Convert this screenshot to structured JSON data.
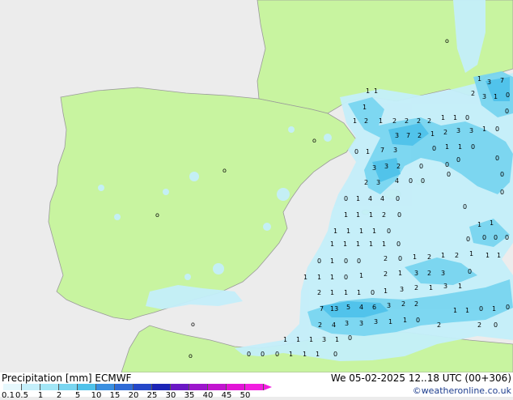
{
  "title": "Precipitation [mm] ECMWF",
  "valid_time": "We 05-02-2025 12..18 UTC (00+306)",
  "credit": "©weatheronline.co.uk",
  "colorbar": {
    "labels": [
      "0.1",
      "0.5",
      "1",
      "2",
      "5",
      "10",
      "15",
      "20",
      "25",
      "30",
      "35",
      "40",
      "45",
      "50"
    ],
    "colors": [
      "#e6f8fd",
      "#c4effa",
      "#a2e6f6",
      "#79d5f0",
      "#4fc2ea",
      "#3a8fe0",
      "#2f6bd6",
      "#2547c8",
      "#1c25b6",
      "#6a18c4",
      "#9c16cc",
      "#c214d0",
      "#e214d6",
      "#f21ee0"
    ]
  },
  "map_values": [
    {
      "v": "1"
    },
    {
      "v": "1"
    },
    {
      "v": "1"
    },
    {
      "v": "1"
    },
    {
      "v": "2"
    },
    {
      "v": "1"
    },
    {
      "v": "2"
    },
    {
      "v": "2"
    },
    {
      "v": "2"
    },
    {
      "v": "2"
    },
    {
      "v": "1"
    },
    {
      "v": "1"
    },
    {
      "v": "0"
    },
    {
      "v": "3"
    },
    {
      "v": "7"
    },
    {
      "v": "2"
    },
    {
      "v": "1"
    },
    {
      "v": "2"
    },
    {
      "v": "3"
    },
    {
      "v": "3"
    },
    {
      "v": "1"
    },
    {
      "v": "0"
    },
    {
      "v": "0"
    },
    {
      "v": "1"
    },
    {
      "v": "7"
    },
    {
      "v": "3"
    },
    {
      "v": "0"
    },
    {
      "v": "1"
    },
    {
      "v": "1"
    },
    {
      "v": "0"
    },
    {
      "v": "3"
    },
    {
      "v": "3"
    },
    {
      "v": "2"
    },
    {
      "v": "0"
    },
    {
      "v": "0"
    },
    {
      "v": "2"
    },
    {
      "v": "3"
    },
    {
      "v": "4"
    },
    {
      "v": "0"
    },
    {
      "v": "0"
    },
    {
      "v": "0"
    },
    {
      "v": "1"
    },
    {
      "v": "4"
    },
    {
      "v": "4"
    },
    {
      "v": "0"
    },
    {
      "v": "1"
    },
    {
      "v": "1"
    },
    {
      "v": "1"
    },
    {
      "v": "2"
    },
    {
      "v": "0"
    },
    {
      "v": "1"
    },
    {
      "v": "1"
    },
    {
      "v": "1"
    },
    {
      "v": "1"
    },
    {
      "v": "0"
    },
    {
      "v": "1"
    },
    {
      "v": "1"
    },
    {
      "v": "1"
    },
    {
      "v": "1"
    },
    {
      "v": "1"
    },
    {
      "v": "0"
    },
    {
      "v": "0"
    },
    {
      "v": "1"
    },
    {
      "v": "0"
    },
    {
      "v": "0"
    },
    {
      "v": "2"
    },
    {
      "v": "0"
    },
    {
      "v": "1"
    },
    {
      "v": "2"
    },
    {
      "v": "1"
    },
    {
      "v": "2"
    },
    {
      "v": "1"
    },
    {
      "v": "1"
    },
    {
      "v": "1"
    },
    {
      "v": "1"
    },
    {
      "v": "0"
    },
    {
      "v": "1"
    },
    {
      "v": "2"
    },
    {
      "v": "1"
    },
    {
      "v": "3"
    },
    {
      "v": "2"
    },
    {
      "v": "3"
    },
    {
      "v": "0"
    },
    {
      "v": "2"
    },
    {
      "v": "1"
    },
    {
      "v": "1"
    },
    {
      "v": "1"
    },
    {
      "v": "0"
    },
    {
      "v": "1"
    },
    {
      "v": "3"
    },
    {
      "v": "2"
    },
    {
      "v": "1"
    },
    {
      "v": "3"
    },
    {
      "v": "1"
    },
    {
      "v": "7"
    },
    {
      "v": "13"
    },
    {
      "v": "5"
    },
    {
      "v": "4"
    },
    {
      "v": "6"
    },
    {
      "v": "3"
    },
    {
      "v": "2"
    },
    {
      "v": "2"
    },
    {
      "v": "2"
    },
    {
      "v": "4"
    },
    {
      "v": "3"
    },
    {
      "v": "3"
    },
    {
      "v": "3"
    },
    {
      "v": "1"
    },
    {
      "v": "1"
    },
    {
      "v": "0"
    },
    {
      "v": "1"
    },
    {
      "v": "1"
    },
    {
      "v": "1"
    },
    {
      "v": "3"
    },
    {
      "v": "1"
    },
    {
      "v": "0"
    },
    {
      "v": "0"
    },
    {
      "v": "0"
    },
    {
      "v": "0"
    },
    {
      "v": "1"
    },
    {
      "v": "1"
    },
    {
      "v": "1"
    },
    {
      "v": "0"
    },
    {
      "v": "1"
    },
    {
      "v": "1"
    },
    {
      "v": "0"
    },
    {
      "v": "1"
    },
    {
      "v": "0"
    },
    {
      "v": "2"
    },
    {
      "v": "2"
    },
    {
      "v": "0"
    },
    {
      "v": "1"
    },
    {
      "v": "3"
    },
    {
      "v": "7"
    },
    {
      "v": "2"
    },
    {
      "v": "3"
    },
    {
      "v": "1"
    },
    {
      "v": "0"
    },
    {
      "v": "0"
    },
    {
      "v": "1"
    },
    {
      "v": "1"
    },
    {
      "v": "0"
    },
    {
      "v": "0"
    },
    {
      "v": "0"
    },
    {
      "v": "0"
    },
    {
      "v": "1"
    },
    {
      "v": "1"
    },
    {
      "v": "0"
    },
    {
      "v": "0"
    },
    {
      "v": "0"
    },
    {
      "v": "0"
    },
    {
      "v": "0"
    },
    {
      "v": "0"
    }
  ]
}
